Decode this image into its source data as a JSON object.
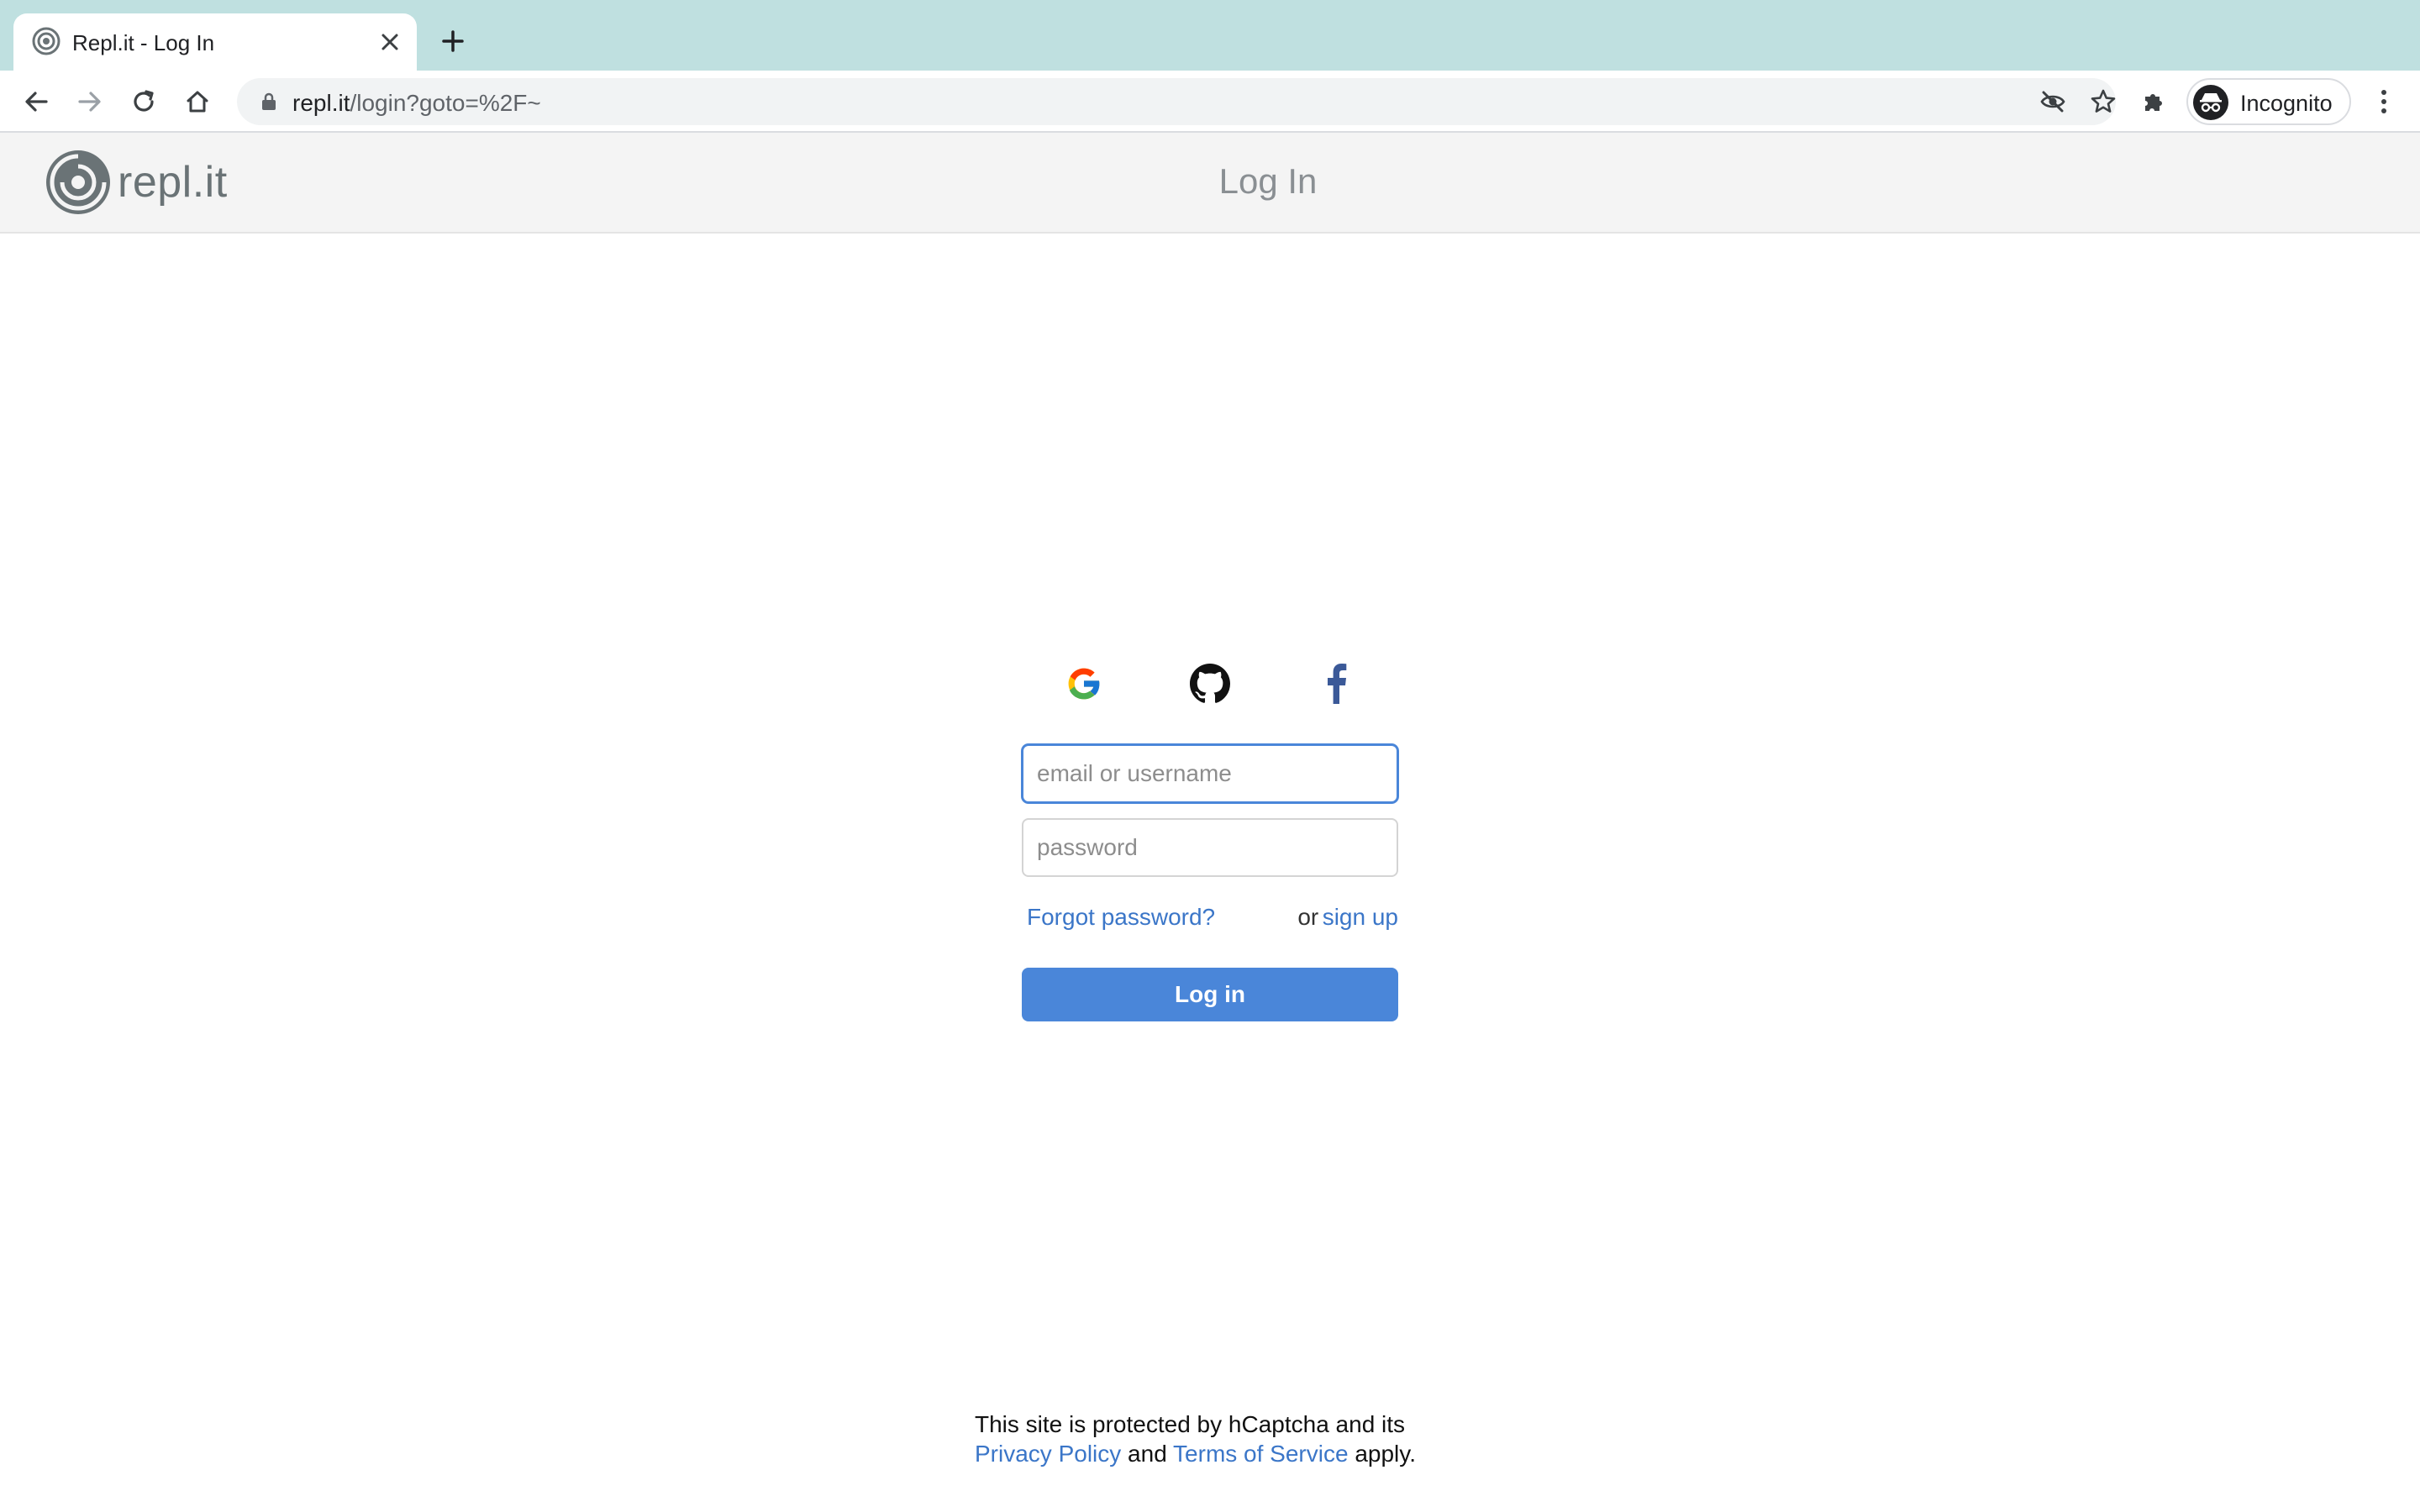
{
  "browser": {
    "tab": {
      "title": "Repl.it - Log In"
    },
    "url": {
      "host": "repl.it",
      "path": "/login?goto=%2F~"
    },
    "profile": {
      "label": "Incognito"
    }
  },
  "header": {
    "logo_text": "repl.it",
    "title": "Log In"
  },
  "login": {
    "social": [
      "google-icon",
      "github-icon",
      "facebook-icon"
    ],
    "username_placeholder": "email or username",
    "password_placeholder": "password",
    "forgot_label": "Forgot password?",
    "or_label": "or",
    "signup_label": "sign up",
    "submit_label": "Log in"
  },
  "footer": {
    "line1": "This site is protected by hCaptcha and its",
    "privacy_label": "Privacy Policy",
    "and_label": "and",
    "terms_label": "Terms of Service",
    "apply_label": "apply."
  },
  "colors": {
    "tabbar": "#bfe0e0",
    "accent": "#4a86d9",
    "link": "#3b76c8",
    "header_bg": "#f4f4f4"
  }
}
